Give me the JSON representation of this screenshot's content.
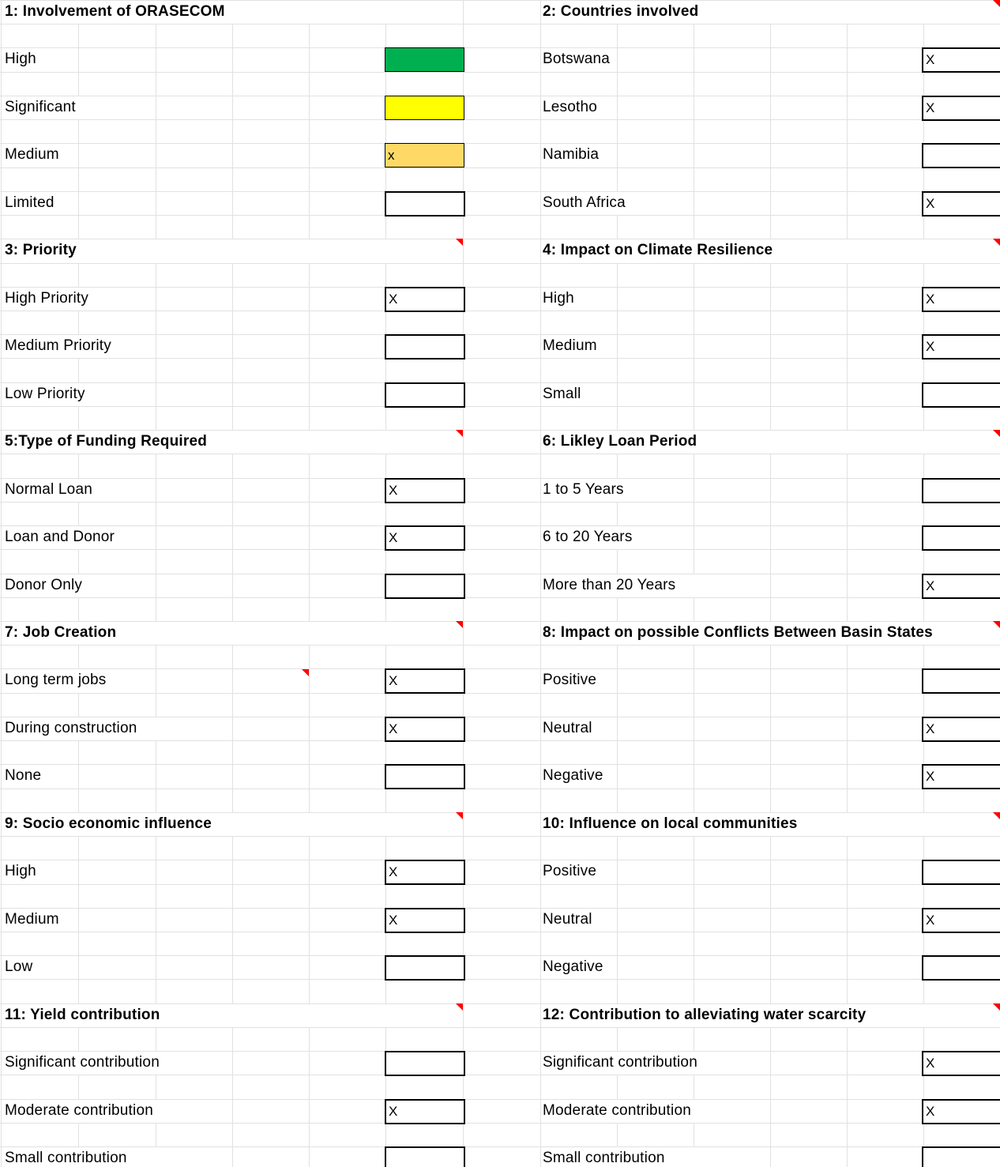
{
  "colors": {
    "grid": "#e1e1e1",
    "high": "#00b050",
    "significant": "#ffff00",
    "medium": "#ffd966",
    "flag": "#ff0000"
  },
  "left_sections": [
    {
      "title": "1: Involvement of ORASECOM",
      "comment_flag": false,
      "options": [
        {
          "label": "High",
          "mark": "",
          "fill": "high"
        },
        {
          "label": "Significant",
          "mark": "",
          "fill": "significant"
        },
        {
          "label": "Medium",
          "mark": "x",
          "fill": "medium"
        },
        {
          "label": "Limited",
          "mark": "",
          "fill": ""
        }
      ]
    },
    {
      "title": "3: Priority",
      "comment_flag": true,
      "options": [
        {
          "label": "High Priority",
          "mark": "X"
        },
        {
          "label": "Medium Priority",
          "mark": ""
        },
        {
          "label": "Low Priority",
          "mark": ""
        }
      ]
    },
    {
      "title": "5:Type of Funding Required",
      "comment_flag": true,
      "options": [
        {
          "label": "Normal Loan",
          "mark": "X"
        },
        {
          "label": "Loan and Donor",
          "mark": "X"
        },
        {
          "label": "Donor Only",
          "mark": ""
        }
      ]
    },
    {
      "title": "7:  Job Creation",
      "comment_flag": true,
      "options": [
        {
          "label": "Long term jobs",
          "mark": "X",
          "label_flag": true
        },
        {
          "label": "During construction",
          "mark": "X"
        },
        {
          "label": "None",
          "mark": ""
        }
      ]
    },
    {
      "title": "9: Socio economic influence",
      "comment_flag": true,
      "options": [
        {
          "label": "High",
          "mark": "X"
        },
        {
          "label": "Medium",
          "mark": "X"
        },
        {
          "label": "Low",
          "mark": ""
        }
      ]
    },
    {
      "title": "11: Yield contribution",
      "comment_flag": true,
      "options": [
        {
          "label": "Significant contribution",
          "mark": ""
        },
        {
          "label": "Moderate contribution",
          "mark": "X"
        },
        {
          "label": "Small contribution",
          "mark": ""
        }
      ]
    }
  ],
  "right_sections": [
    {
      "title": "2: Countries involved",
      "comment_flag": true,
      "options": [
        {
          "label": "Botswana",
          "mark": "X"
        },
        {
          "label": "Lesotho",
          "mark": "X"
        },
        {
          "label": "Namibia",
          "mark": ""
        },
        {
          "label": "South Africa",
          "mark": "X"
        }
      ]
    },
    {
      "title": "4: Impact on Climate Resilience",
      "comment_flag": true,
      "options": [
        {
          "label": "High",
          "mark": "X"
        },
        {
          "label": "Medium",
          "mark": "X"
        },
        {
          "label": "Small",
          "mark": ""
        }
      ]
    },
    {
      "title": "6: Likley Loan Period",
      "comment_flag": true,
      "options": [
        {
          "label": "1 to 5 Years",
          "mark": ""
        },
        {
          "label": "6 to 20 Years",
          "mark": ""
        },
        {
          "label": "More than 20 Years",
          "mark": "X"
        }
      ]
    },
    {
      "title": "8: Impact on possible  Conflicts Between Basin States",
      "comment_flag": true,
      "options": [
        {
          "label": "Positive",
          "mark": ""
        },
        {
          "label": "Neutral",
          "mark": "X"
        },
        {
          "label": "Negative",
          "mark": "X"
        }
      ]
    },
    {
      "title": "10: Influence on local communities",
      "comment_flag": true,
      "options": [
        {
          "label": "Positive",
          "mark": ""
        },
        {
          "label": "Neutral",
          "mark": "X"
        },
        {
          "label": "Negative",
          "mark": ""
        }
      ]
    },
    {
      "title": "12: Contribution to alleviating water scarcity",
      "comment_flag": true,
      "options": [
        {
          "label": "Significant contribution",
          "mark": "X"
        },
        {
          "label": "Moderate contribution",
          "mark": "X"
        },
        {
          "label": "Small contribution",
          "mark": ""
        }
      ]
    }
  ]
}
